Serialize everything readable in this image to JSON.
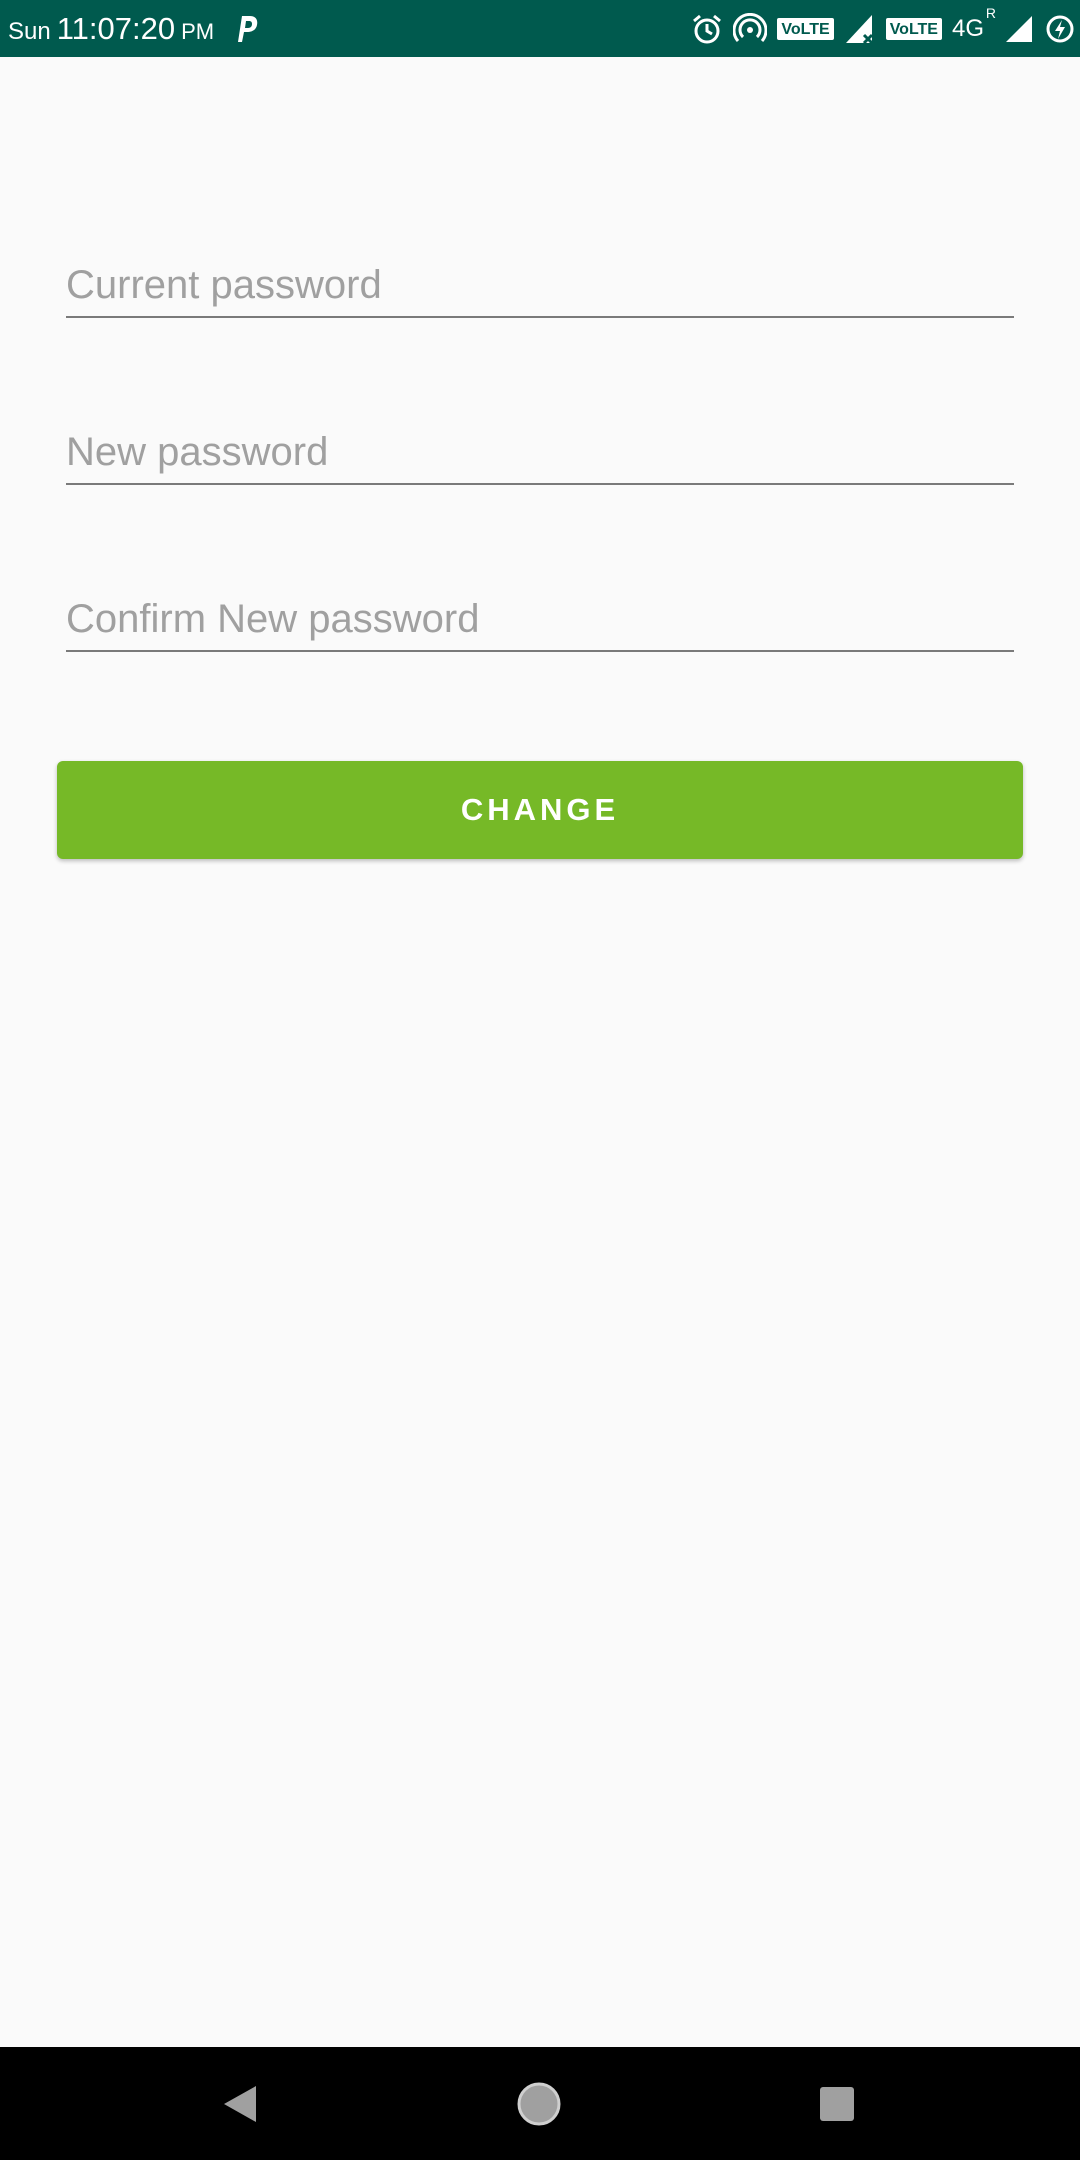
{
  "status_bar": {
    "day": "Sun",
    "time": "11:07:20",
    "ampm": "PM",
    "volte_1": "VoLTE",
    "volte_2": "VoLTE",
    "network": "4G",
    "roaming": "R",
    "background_color": "#005a4e"
  },
  "form": {
    "current_password_placeholder": "Current password",
    "new_password_placeholder": "New password",
    "confirm_password_placeholder": "Confirm New password",
    "current_password_value": "",
    "new_password_value": "",
    "confirm_password_value": "",
    "change_button_label": "CHANGE",
    "accent_color": "#76b927"
  },
  "nav_bar": {
    "back_icon": "back-triangle-icon",
    "home_icon": "home-circle-icon",
    "recents_icon": "recents-square-icon"
  }
}
